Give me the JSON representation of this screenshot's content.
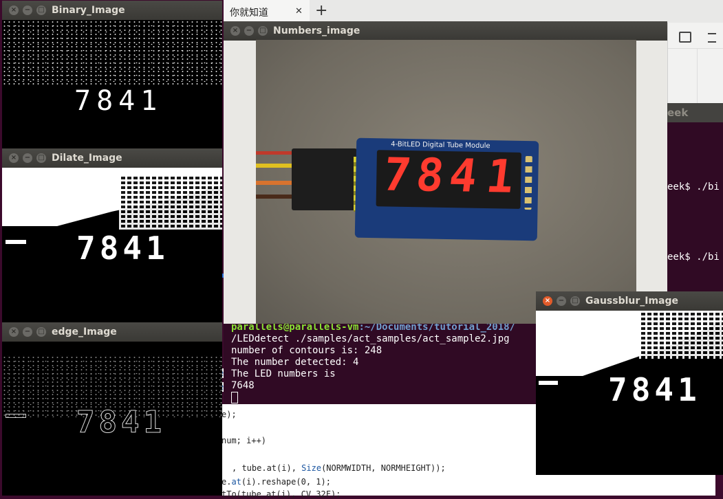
{
  "browser": {
    "tab_title": "你就知道",
    "close_glyph": "✕",
    "new_tab_glyph": "+"
  },
  "windows": {
    "binary": {
      "title": "Binary_Image",
      "digits": "7841"
    },
    "dilate": {
      "title": "Dilate_Image",
      "digits": "7841"
    },
    "edge": {
      "title": "edge_Image",
      "digits": "7841"
    },
    "numbers": {
      "title": "Numbers_image",
      "module_label": "4-BitLED Digital Tube Module",
      "digits": [
        "7",
        "8",
        "4",
        "1"
      ]
    },
    "gauss": {
      "title": "Gaussblur_Image",
      "digits": "7841"
    },
    "side_terminal": {
      "title_fragment": "eek",
      "line1": "eek$ ./bi",
      "line2": "eek$ ./bi"
    }
  },
  "terminal": {
    "prompt_user": "parallels@parallels-vm",
    "prompt_path": ":~/Documents/tutorial_2018/",
    "lines": [
      "/LEDdetect ./samples/act_samples/act_sample2.jpg",
      "number of contours is: 248",
      "The number detected: 4",
      "The LED numbers is",
      "7648"
    ]
  },
  "editor": {
    "frag_e": "e",
    "frag_es": "es",
    "frag_close": "e);",
    "line_loop": "num; i++)",
    "line_resize_pre": ", tube.at(i), ",
    "line_resize_kw": "Size",
    "line_resize_post": "(NORMWIDTH, NORMHEIGHT));",
    "line_reshape_e": "e.",
    "line_reshape_kw": "at",
    "line_reshape_post": "(i).reshape(0, 1);",
    "line_last": "tTo(tube.at(i), CV_32F);"
  },
  "tb_glyphs": {
    "close": "×",
    "min": "−",
    "max": "□"
  },
  "colors": {
    "ubuntu_terminal_bg": "#300a24",
    "led_red": "#ff3b2f",
    "close_active": "#e25b2a"
  }
}
